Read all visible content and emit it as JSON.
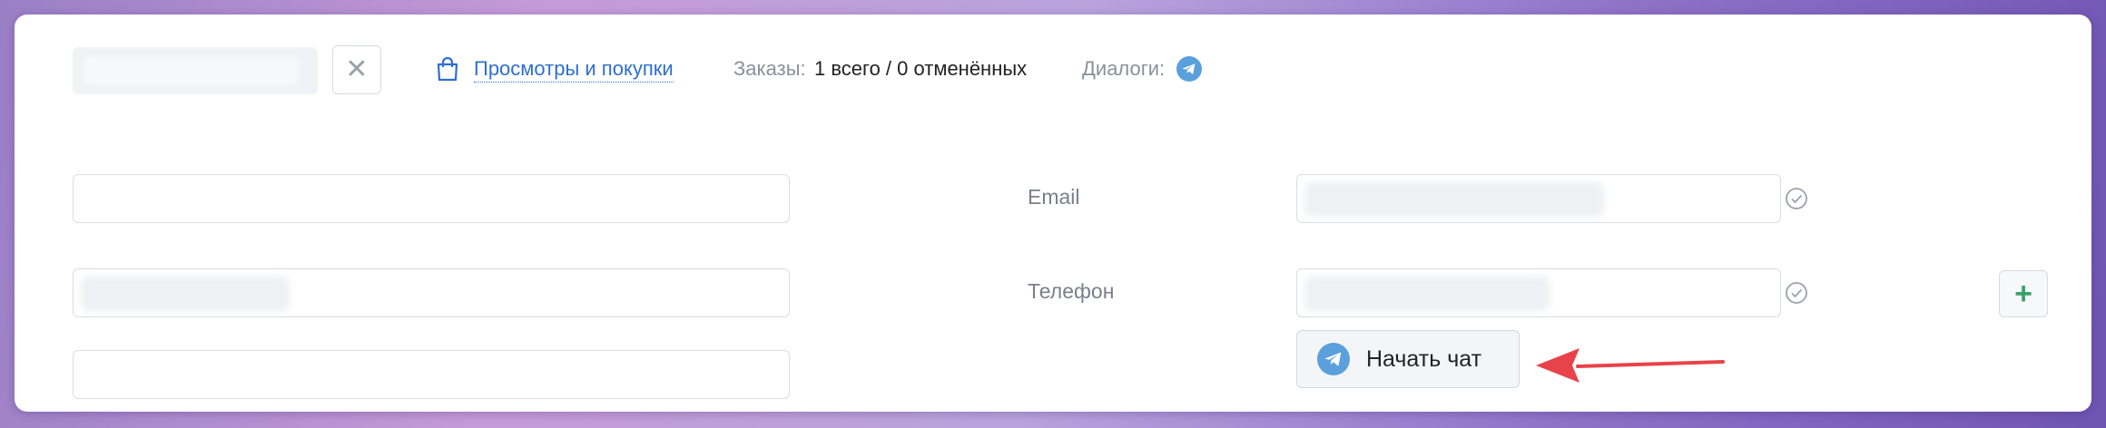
{
  "header": {
    "link_label": "Просмотры и покупки",
    "orders_label": "Заказы:",
    "orders_value": "1 всего / 0 отменённых",
    "dialogs_label": "Диалоги:",
    "close_symbol": "✕"
  },
  "form": {
    "email_label": "Email",
    "phone_label": "Телефон",
    "add_symbol": "+",
    "start_chat_label": "Начать чат"
  },
  "colors": {
    "link": "#2f6fd0",
    "telegram": "#5aa0dc",
    "add": "#3aa36a",
    "annotation_arrow": "#e8434a"
  },
  "icons": [
    "shopping-bag-icon",
    "close-icon",
    "telegram-icon",
    "check-circle-icon",
    "plus-icon",
    "arrow-annotation"
  ]
}
